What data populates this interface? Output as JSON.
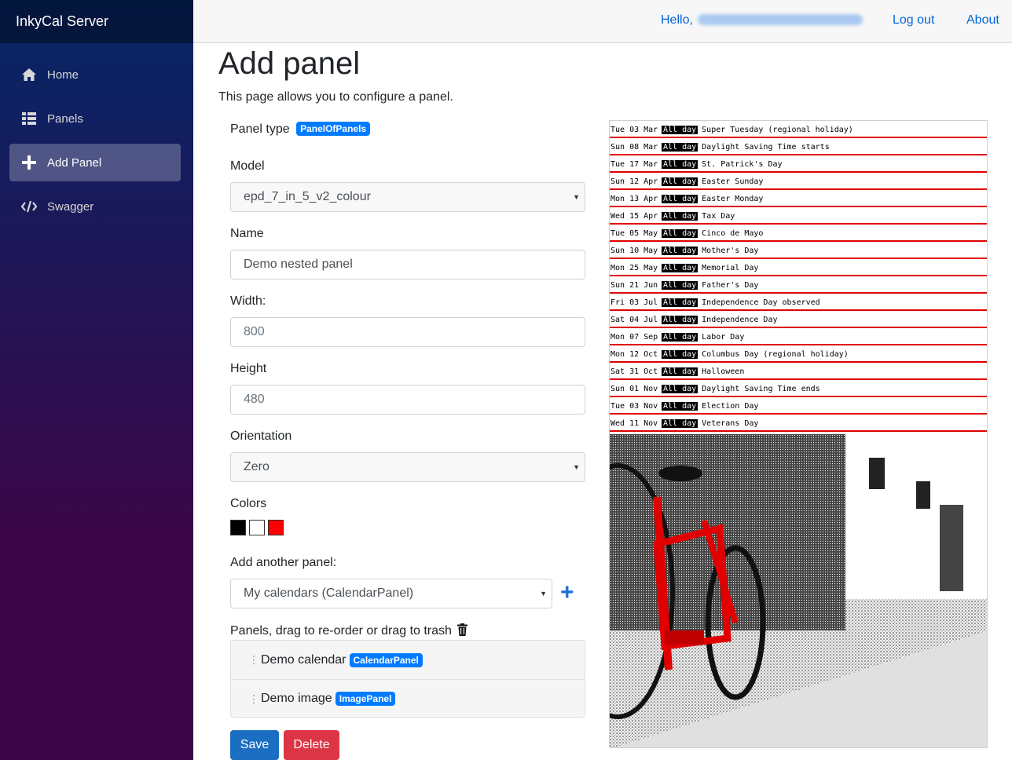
{
  "app": {
    "title": "InkyCal Server"
  },
  "sidebar": {
    "items": [
      {
        "label": "Home",
        "icon": "home-icon",
        "active": false
      },
      {
        "label": "Panels",
        "icon": "list-icon",
        "active": false
      },
      {
        "label": "Add Panel",
        "icon": "plus-icon",
        "active": true
      },
      {
        "label": "Swagger",
        "icon": "code-icon",
        "active": false
      }
    ]
  },
  "topbar": {
    "hello": "Hello,",
    "logout": "Log out",
    "about": "About"
  },
  "page": {
    "title": "Add panel",
    "description": "This page allows you to configure a panel."
  },
  "form": {
    "panel_type_label": "Panel type",
    "panel_type_badge": "PanelOfPanels",
    "model_label": "Model",
    "model_value": "epd_7_in_5_v2_colour",
    "name_label": "Name",
    "name_value": "Demo nested panel",
    "width_label": "Width:",
    "width_value": "800",
    "height_label": "Height",
    "height_value": "480",
    "orientation_label": "Orientation",
    "orientation_value": "Zero",
    "colors_label": "Colors",
    "colors": [
      "#000000",
      "#ffffff",
      "#ff0000"
    ],
    "add_panel_label": "Add another panel:",
    "add_panel_value": "My calendars (CalendarPanel)",
    "panels_label": "Panels, drag to re-order or drag to trash",
    "panels": [
      {
        "name": "Demo calendar",
        "type": "CalendarPanel"
      },
      {
        "name": "Demo image",
        "type": "ImagePanel"
      }
    ],
    "save_label": "Save",
    "delete_label": "Delete"
  },
  "preview": {
    "allday_label": "All day",
    "events": [
      {
        "date": "Tue 03 Mar",
        "title": "Super Tuesday (regional holiday)"
      },
      {
        "date": "Sun 08 Mar",
        "title": "Daylight Saving Time starts"
      },
      {
        "date": "Tue 17 Mar",
        "title": "St. Patrick's Day"
      },
      {
        "date": "Sun 12 Apr",
        "title": "Easter Sunday"
      },
      {
        "date": "Mon 13 Apr",
        "title": "Easter Monday"
      },
      {
        "date": "Wed 15 Apr",
        "title": "Tax Day"
      },
      {
        "date": "Tue 05 May",
        "title": "Cinco de Mayo"
      },
      {
        "date": "Sun 10 May",
        "title": "Mother's Day"
      },
      {
        "date": "Mon 25 May",
        "title": "Memorial Day"
      },
      {
        "date": "Sun 21 Jun",
        "title": "Father's Day"
      },
      {
        "date": "Fri 03 Jul",
        "title": "Independence Day observed"
      },
      {
        "date": "Sat 04 Jul",
        "title": "Independence Day"
      },
      {
        "date": "Mon 07 Sep",
        "title": "Labor Day"
      },
      {
        "date": "Mon 12 Oct",
        "title": "Columbus Day (regional holiday)"
      },
      {
        "date": "Sat 31 Oct",
        "title": "Halloween"
      },
      {
        "date": "Sun 01 Nov",
        "title": "Daylight Saving Time ends"
      },
      {
        "date": "Tue 03 Nov",
        "title": "Election Day"
      },
      {
        "date": "Wed 11 Nov",
        "title": "Veterans Day"
      }
    ]
  }
}
